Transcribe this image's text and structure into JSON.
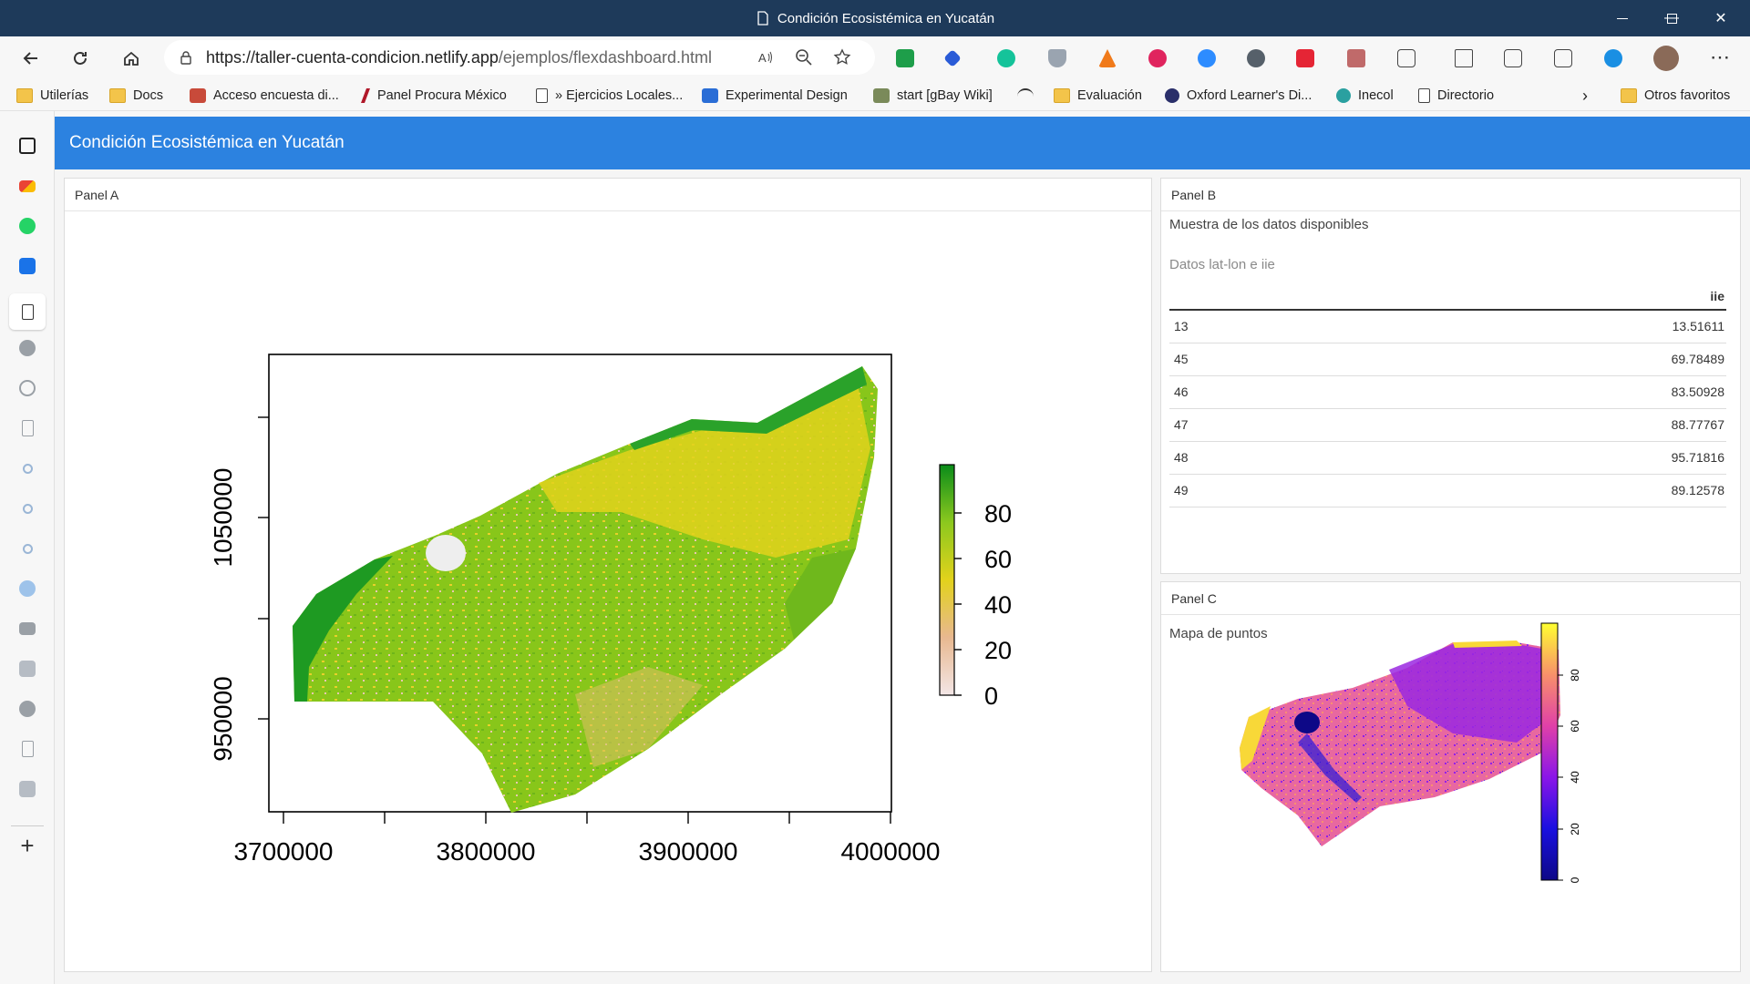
{
  "window": {
    "title": "Condición Ecosistémica en Yucatán",
    "minimize": "—",
    "maximize": "❐",
    "close": "✕"
  },
  "address": {
    "url_host": "https://taller-cuenta-condicion.netlify.app",
    "url_path": "/ejemplos/flexdashboard.html"
  },
  "bookmarks": [
    {
      "label": "Utilerías",
      "icon": "folder-icon"
    },
    {
      "label": "Docs",
      "icon": "folder-icon"
    },
    {
      "label": "Acceso encuesta di...",
      "icon": "survey-icon"
    },
    {
      "label": "Panel Procura México",
      "icon": "procura-icon"
    },
    {
      "label": "» Ejercicios Locales...",
      "icon": "page-icon"
    },
    {
      "label": "Experimental Design",
      "icon": "st-icon"
    },
    {
      "label": "start [gBay Wiki]",
      "icon": "wiki-icon"
    },
    {
      "label": "",
      "icon": "signal-icon"
    },
    {
      "label": "Evaluación",
      "icon": "folder-icon"
    },
    {
      "label": "Oxford Learner's Di...",
      "icon": "oxford-icon"
    },
    {
      "label": "Inecol",
      "icon": "inecol-icon"
    },
    {
      "label": "Directorio",
      "icon": "page-icon"
    },
    {
      "label": "Otros favoritos",
      "icon": "folder-icon"
    }
  ],
  "header": {
    "title": "Condición Ecosistémica en Yucatán"
  },
  "panelA": {
    "title": "Panel A",
    "map": {
      "x_ticks": [
        "3700000",
        "3800000",
        "3900000",
        "4000000"
      ],
      "y_ticks": [
        "950000",
        "1050000"
      ],
      "legend_ticks": [
        "0",
        "20",
        "40",
        "60",
        "80"
      ],
      "colors": {
        "high": "#0a8c1a",
        "mid": "#e2d21c",
        "low": "#f3e6e6"
      }
    }
  },
  "panelB": {
    "title": "Panel B",
    "subtitle": "Muestra de los datos disponibles",
    "caption": "Datos lat-lon e iie",
    "column_header": "iie",
    "rows": [
      {
        "id": "13",
        "iie": "13.51611"
      },
      {
        "id": "45",
        "iie": "69.78489"
      },
      {
        "id": "46",
        "iie": "83.50928"
      },
      {
        "id": "47",
        "iie": "88.77767"
      },
      {
        "id": "48",
        "iie": "95.71816"
      },
      {
        "id": "49",
        "iie": "89.12578"
      }
    ]
  },
  "panelC": {
    "title": "Panel C",
    "subtitle": "Mapa de puntos",
    "legend_ticks": [
      "0",
      "20",
      "40",
      "60",
      "80"
    ]
  }
}
